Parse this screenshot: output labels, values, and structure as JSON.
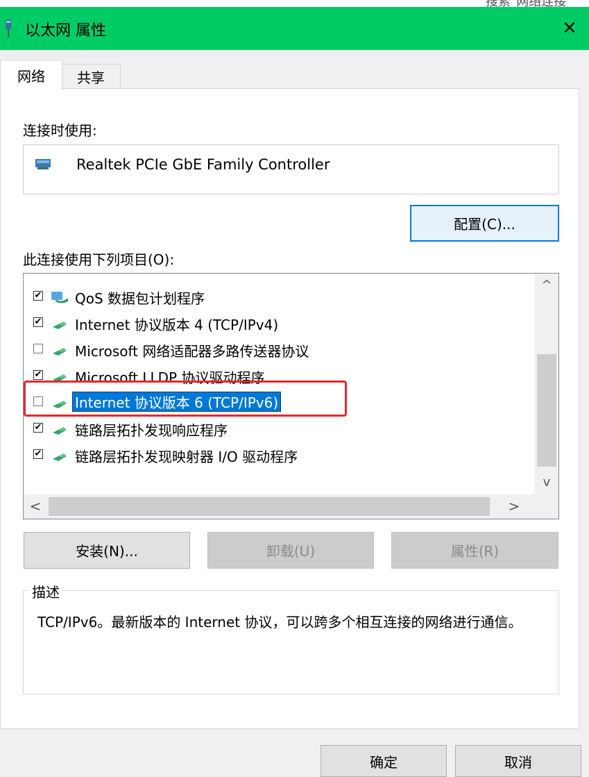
{
  "background_window": {
    "text": "搜索\"网络连接\""
  },
  "window": {
    "title": "以太网 属性",
    "close_glyph": "✕",
    "accent_color": "#00cc66"
  },
  "tabs": [
    {
      "label": "网络",
      "active": true
    },
    {
      "label": "共享",
      "active": false
    }
  ],
  "connect_using": {
    "label": "连接时使用:",
    "adapter_name": "Realtek PCIe GbE Family Controller",
    "configure_button": "配置(C)..."
  },
  "items_section": {
    "label": "此连接使用下列项目(O):",
    "items": [
      {
        "label": "QoS 数据包计划程序",
        "checked": true,
        "icon": "qos-scheduler-icon"
      },
      {
        "label": "Internet 协议版本 4 (TCP/IPv4)",
        "checked": true,
        "icon": "network-protocol-icon"
      },
      {
        "label": "Microsoft 网络适配器多路传送器协议",
        "checked": false,
        "icon": "network-protocol-icon"
      },
      {
        "label": "Microsoft LLDP 协议驱动程序",
        "checked": true,
        "icon": "network-protocol-icon"
      },
      {
        "label": "Internet 协议版本 6 (TCP/IPv6)",
        "checked": false,
        "icon": "network-protocol-icon",
        "selected": true,
        "annotated": true
      },
      {
        "label": "链路层拓扑发现响应程序",
        "checked": true,
        "icon": "network-protocol-icon"
      },
      {
        "label": "链路层拓扑发现映射器 I/O 驱动程序",
        "checked": true,
        "icon": "network-protocol-icon"
      }
    ],
    "scroll_up_glyph": "^",
    "scroll_down_glyph": "v",
    "scroll_left_glyph": "<",
    "scroll_right_glyph": ">"
  },
  "action_buttons": {
    "install": "安装(N)...",
    "uninstall": "卸载(U)",
    "properties": "属性(R)"
  },
  "description": {
    "title": "描述",
    "text": "TCP/IPv6。最新版本的 Internet 协议，可以跨多个相互连接的网络进行通信。"
  },
  "footer": {
    "ok": "确定",
    "cancel": "取消"
  },
  "colors": {
    "selection": "#0078d7",
    "annotation_box": "#e8262a"
  }
}
